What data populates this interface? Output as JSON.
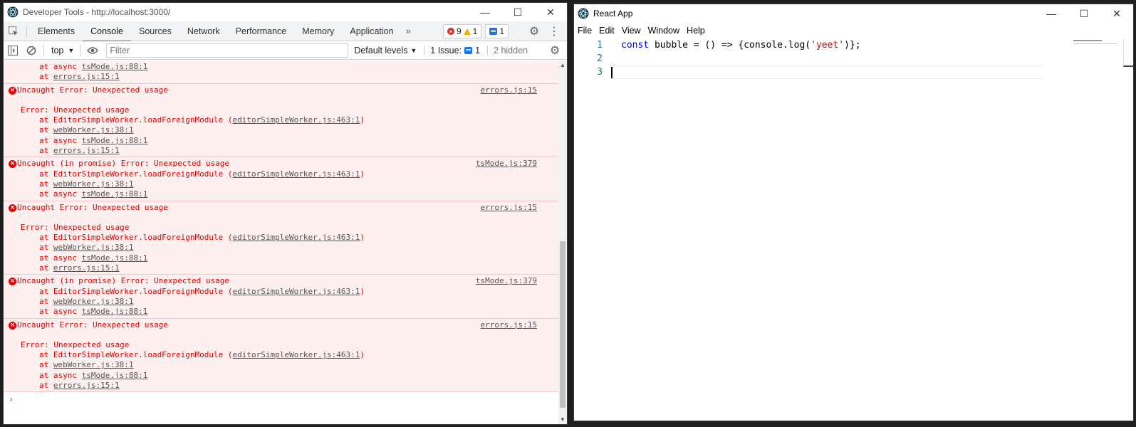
{
  "devtools": {
    "title": "Developer Tools - http://localhost:3000/",
    "tabs": [
      "Elements",
      "Console",
      "Sources",
      "Network",
      "Performance",
      "Memory",
      "Application"
    ],
    "more_tabs": "»",
    "badges": {
      "errors": "9",
      "warnings": "1",
      "messages": "1"
    },
    "toolbar": {
      "context": "top",
      "filter_placeholder": "Filter",
      "levels": "Default levels",
      "issues_label": "1 Issue:",
      "issues_count": "1",
      "hidden": "2 hidden"
    },
    "messages": [
      {
        "type": "partial",
        "lines": [
          {
            "prefix": "at async ",
            "link": "tsMode.js:88:1"
          },
          {
            "prefix": "at ",
            "link": "errors.js:15:1"
          }
        ]
      },
      {
        "type": "error",
        "header": "Uncaught Error: Unexpected usage",
        "source": "errors.js:15",
        "body_title": "Error: Unexpected usage",
        "lines": [
          {
            "prefix": "at EditorSimpleWorker.loadForeignModule (",
            "link": "editorSimpleWorker.js:463:1",
            "suffix": ")"
          },
          {
            "prefix": "at ",
            "link": "webWorker.js:38:1"
          },
          {
            "prefix": "at async ",
            "link": "tsMode.js:88:1"
          },
          {
            "prefix": "at ",
            "link": "errors.js:15:1"
          }
        ]
      },
      {
        "type": "promise",
        "header": "Uncaught (in promise) Error: Unexpected usage",
        "source": "tsMode.js:379",
        "lines": [
          {
            "prefix": "at EditorSimpleWorker.loadForeignModule (",
            "link": "editorSimpleWorker.js:463:1",
            "suffix": ")"
          },
          {
            "prefix": "at ",
            "link": "webWorker.js:38:1"
          },
          {
            "prefix": "at async ",
            "link": "tsMode.js:88:1"
          }
        ]
      },
      {
        "type": "error",
        "header": "Uncaught Error: Unexpected usage",
        "source": "errors.js:15",
        "body_title": "Error: Unexpected usage",
        "lines": [
          {
            "prefix": "at EditorSimpleWorker.loadForeignModule (",
            "link": "editorSimpleWorker.js:463:1",
            "suffix": ")"
          },
          {
            "prefix": "at ",
            "link": "webWorker.js:38:1"
          },
          {
            "prefix": "at async ",
            "link": "tsMode.js:88:1"
          },
          {
            "prefix": "at ",
            "link": "errors.js:15:1"
          }
        ]
      },
      {
        "type": "promise",
        "header": "Uncaught (in promise) Error: Unexpected usage",
        "source": "tsMode.js:379",
        "lines": [
          {
            "prefix": "at EditorSimpleWorker.loadForeignModule (",
            "link": "editorSimpleWorker.js:463:1",
            "suffix": ")"
          },
          {
            "prefix": "at ",
            "link": "webWorker.js:38:1"
          },
          {
            "prefix": "at async ",
            "link": "tsMode.js:88:1"
          }
        ]
      },
      {
        "type": "error",
        "header": "Uncaught Error: Unexpected usage",
        "source": "errors.js:15",
        "body_title": "Error: Unexpected usage",
        "lines": [
          {
            "prefix": "at EditorSimpleWorker.loadForeignModule (",
            "link": "editorSimpleWorker.js:463:1",
            "suffix": ")"
          },
          {
            "prefix": "at ",
            "link": "webWorker.js:38:1"
          },
          {
            "prefix": "at async ",
            "link": "tsMode.js:88:1"
          },
          {
            "prefix": "at ",
            "link": "errors.js:15:1"
          }
        ]
      }
    ],
    "prompt": "›"
  },
  "react": {
    "title": "React App",
    "menu": [
      "File",
      "Edit",
      "View",
      "Window",
      "Help"
    ],
    "editor": {
      "line_numbers": [
        "1",
        "2",
        "3"
      ],
      "code": {
        "kw": "const",
        "ident": " bubble = () => {console.log(",
        "str": "'yeet'",
        "end": ")};"
      }
    }
  },
  "colors": {
    "error_red": "#e50000",
    "error_bg": "#fff0f0",
    "accent_blue": "#1a73e8"
  }
}
